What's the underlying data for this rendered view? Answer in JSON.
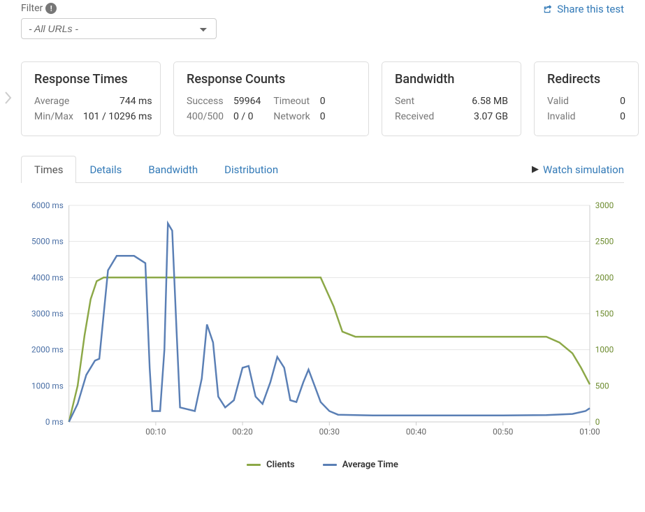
{
  "filter": {
    "label": "Filter",
    "selected": "- All URLs -"
  },
  "share_link": "Share this test",
  "cards": {
    "response_times": {
      "title": "Response Times",
      "rows": [
        {
          "label": "Average",
          "value": "744 ms"
        },
        {
          "label": "Min/Max",
          "value": "101 / 10296 ms"
        }
      ]
    },
    "response_counts": {
      "title": "Response Counts",
      "rows": [
        {
          "label1": "Success",
          "val1": "59964",
          "label2": "Timeout",
          "val2": "0"
        },
        {
          "label1": "400/500",
          "val1": "0 / 0",
          "label2": "Network",
          "val2": "0"
        }
      ]
    },
    "bandwidth": {
      "title": "Bandwidth",
      "rows": [
        {
          "label": "Sent",
          "value": "6.58 MB"
        },
        {
          "label": "Received",
          "value": "3.07 GB"
        }
      ]
    },
    "redirects": {
      "title": "Redirects",
      "rows": [
        {
          "label": "Valid",
          "value": "0"
        },
        {
          "label": "Invalid",
          "value": "0"
        }
      ]
    }
  },
  "tabs": {
    "times": "Times",
    "details": "Details",
    "bandwidth": "Bandwidth",
    "distribution": "Distribution",
    "active": "times"
  },
  "watch_link": "Watch simulation",
  "legend": {
    "clients": "Clients",
    "avg": "Average Time"
  },
  "chart_data": {
    "type": "line",
    "title": "",
    "xlabel": "",
    "x_ticks": [
      "00:10",
      "00:20",
      "00:30",
      "00:40",
      "00:50",
      "01:00"
    ],
    "left_axis": {
      "label": "ms",
      "ylim": [
        0,
        6000
      ],
      "ticks": [
        0,
        1000,
        2000,
        3000,
        4000,
        5000,
        6000
      ],
      "tick_labels": [
        "0 ms",
        "1000 ms",
        "2000 ms",
        "3000 ms",
        "4000 ms",
        "5000 ms",
        "6000 ms"
      ]
    },
    "right_axis": {
      "label": "",
      "ylim": [
        0,
        3000
      ],
      "ticks": [
        0,
        500,
        1000,
        1500,
        2000,
        2500,
        3000
      ],
      "tick_labels": [
        "0",
        "500",
        "1000",
        "1500",
        "2000",
        "2500",
        "3000"
      ]
    },
    "series": [
      {
        "name": "Clients",
        "axis": "right",
        "color": "#8ca847",
        "points": [
          {
            "x": 0.0,
            "y": 0
          },
          {
            "x": 1.0,
            "y": 500
          },
          {
            "x": 1.8,
            "y": 1200
          },
          {
            "x": 2.5,
            "y": 1700
          },
          {
            "x": 3.2,
            "y": 1950
          },
          {
            "x": 4.0,
            "y": 2000
          },
          {
            "x": 10.0,
            "y": 2000
          },
          {
            "x": 20.0,
            "y": 2000
          },
          {
            "x": 29.0,
            "y": 2000
          },
          {
            "x": 30.5,
            "y": 1600
          },
          {
            "x": 31.5,
            "y": 1250
          },
          {
            "x": 33.0,
            "y": 1180
          },
          {
            "x": 40.0,
            "y": 1180
          },
          {
            "x": 50.0,
            "y": 1180
          },
          {
            "x": 55.0,
            "y": 1180
          },
          {
            "x": 56.5,
            "y": 1100
          },
          {
            "x": 58.0,
            "y": 950
          },
          {
            "x": 59.0,
            "y": 750
          },
          {
            "x": 60.0,
            "y": 520
          }
        ]
      },
      {
        "name": "Average Time",
        "axis": "left",
        "color": "#5a7fb5",
        "points": [
          {
            "x": 0.0,
            "y": 0
          },
          {
            "x": 1.0,
            "y": 500
          },
          {
            "x": 2.0,
            "y": 1300
          },
          {
            "x": 3.0,
            "y": 1700
          },
          {
            "x": 3.5,
            "y": 1750
          },
          {
            "x": 4.5,
            "y": 4200
          },
          {
            "x": 5.5,
            "y": 4600
          },
          {
            "x": 7.5,
            "y": 4600
          },
          {
            "x": 8.8,
            "y": 4400
          },
          {
            "x": 9.3,
            "y": 1500
          },
          {
            "x": 9.6,
            "y": 300
          },
          {
            "x": 10.5,
            "y": 300
          },
          {
            "x": 11.0,
            "y": 2000
          },
          {
            "x": 11.4,
            "y": 5500
          },
          {
            "x": 11.9,
            "y": 5300
          },
          {
            "x": 12.4,
            "y": 2500
          },
          {
            "x": 12.8,
            "y": 400
          },
          {
            "x": 14.5,
            "y": 300
          },
          {
            "x": 15.3,
            "y": 1200
          },
          {
            "x": 15.9,
            "y": 2700
          },
          {
            "x": 16.6,
            "y": 2200
          },
          {
            "x": 17.2,
            "y": 700
          },
          {
            "x": 18.0,
            "y": 400
          },
          {
            "x": 19.0,
            "y": 600
          },
          {
            "x": 20.0,
            "y": 1500
          },
          {
            "x": 20.7,
            "y": 1550
          },
          {
            "x": 21.5,
            "y": 700
          },
          {
            "x": 22.3,
            "y": 500
          },
          {
            "x": 23.2,
            "y": 1100
          },
          {
            "x": 24.0,
            "y": 1800
          },
          {
            "x": 24.8,
            "y": 1500
          },
          {
            "x": 25.5,
            "y": 600
          },
          {
            "x": 26.2,
            "y": 550
          },
          {
            "x": 27.0,
            "y": 1100
          },
          {
            "x": 27.6,
            "y": 1450
          },
          {
            "x": 28.3,
            "y": 1000
          },
          {
            "x": 29.0,
            "y": 550
          },
          {
            "x": 30.0,
            "y": 300
          },
          {
            "x": 31.0,
            "y": 200
          },
          {
            "x": 35.0,
            "y": 180
          },
          {
            "x": 40.0,
            "y": 180
          },
          {
            "x": 45.0,
            "y": 180
          },
          {
            "x": 50.0,
            "y": 180
          },
          {
            "x": 55.0,
            "y": 190
          },
          {
            "x": 58.0,
            "y": 220
          },
          {
            "x": 59.5,
            "y": 300
          },
          {
            "x": 60.0,
            "y": 380
          }
        ]
      }
    ]
  }
}
